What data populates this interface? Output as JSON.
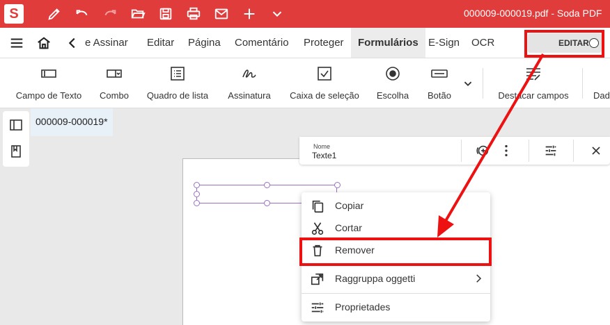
{
  "app": {
    "logo_letter": "S",
    "window_title": "000009-000019.pdf  -  Soda PDF"
  },
  "menu": {
    "items": [
      "e Assinar",
      "Editar",
      "Página",
      "Comentário",
      "Proteger",
      "Formulários",
      "E-Sign",
      "OCR"
    ],
    "active": "Formulários",
    "edit_toggle_label": "EDITAR"
  },
  "ribbon": {
    "items": [
      "Campo de Texto",
      "Combo",
      "Quadro de lista",
      "Assinatura",
      "Caixa de seleção",
      "Escolha",
      "Botão",
      "Destacar campos",
      "Dad"
    ]
  },
  "document": {
    "tab_label": "000009-000019*"
  },
  "field_toolbar": {
    "name_label": "Nome",
    "name_value": "Texte1"
  },
  "context_menu": {
    "items": [
      "Copiar",
      "Cortar",
      "Remover",
      "Raggruppa oggetti",
      "Proprietades"
    ]
  },
  "colors": {
    "brand_red": "#e13c3c",
    "highlight_red": "#ee1111",
    "selection_purple": "#9b6fc7"
  }
}
